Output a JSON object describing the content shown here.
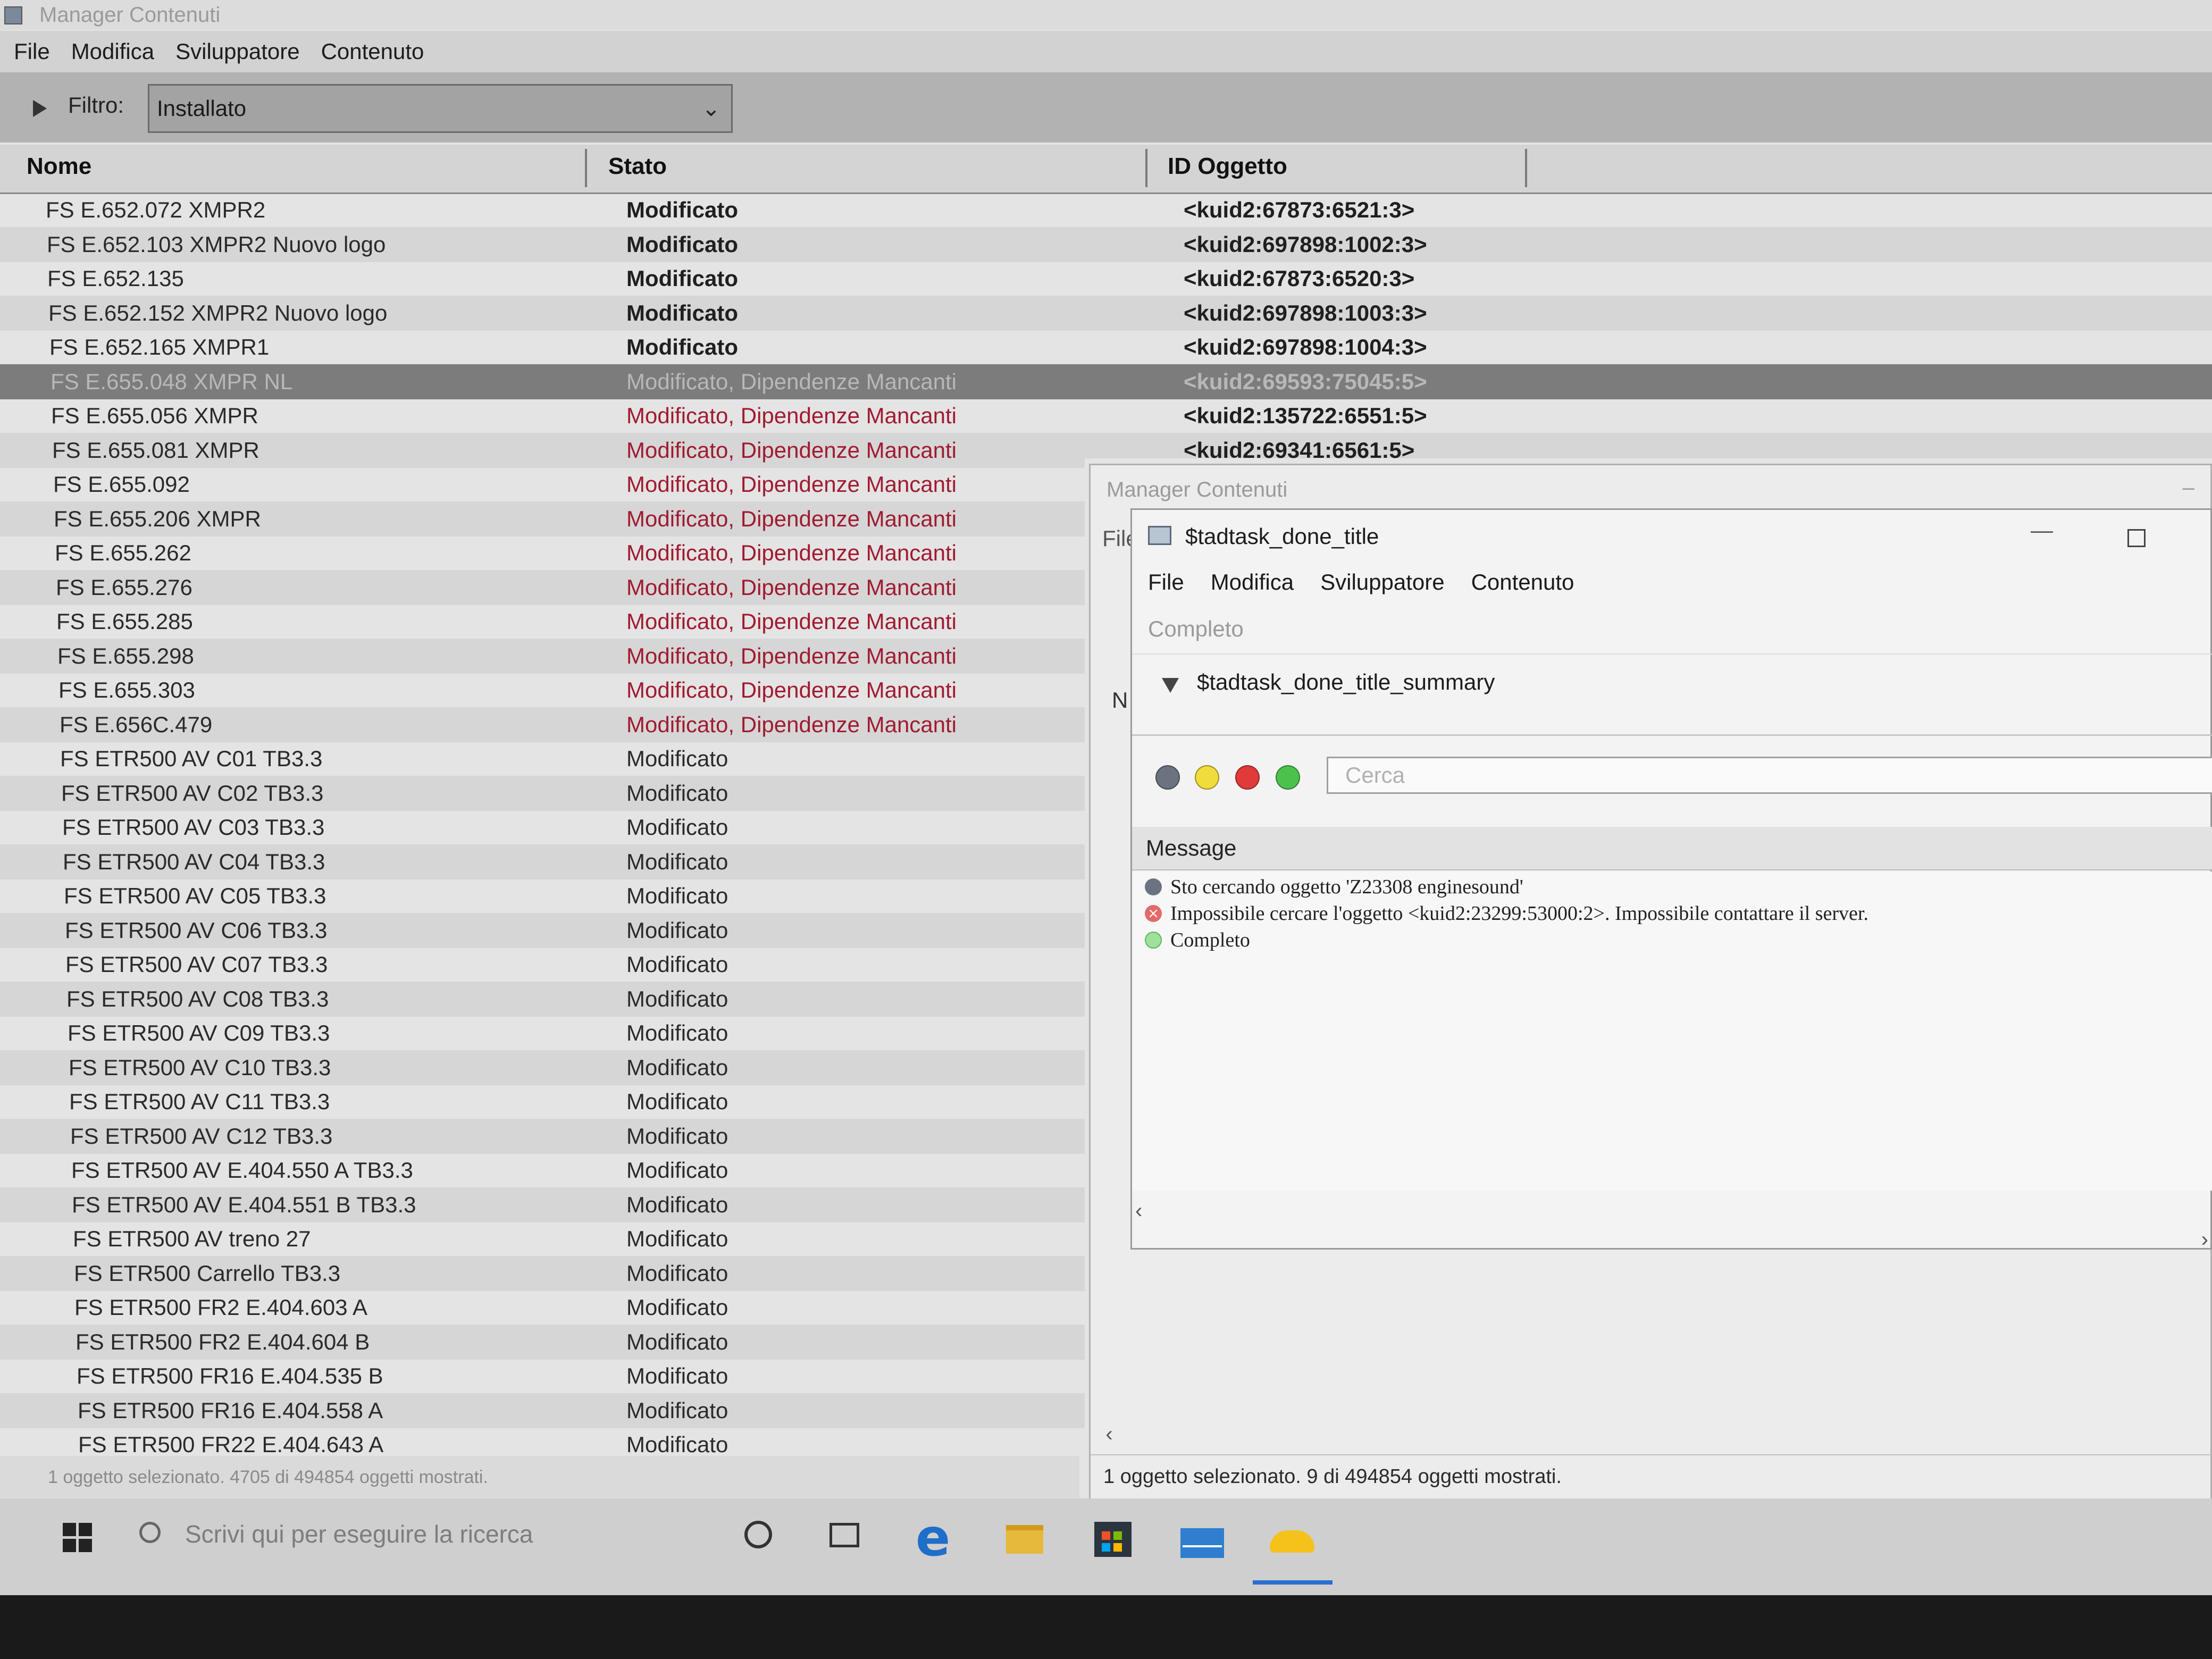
{
  "main_window": {
    "title": "Manager Contenuti",
    "menu": [
      "File",
      "Modifica",
      "Sviluppatore",
      "Contenuto"
    ],
    "filter": {
      "label": "Filtro:",
      "value": "Installato"
    },
    "columns": {
      "name": "Nome",
      "state": "Stato",
      "id": "ID Oggetto"
    },
    "rows": [
      {
        "name": "FS E.652.072 XMPR2",
        "state": "Modificato",
        "id": "<kuid2:67873:6521:3>"
      },
      {
        "name": "FS E.652.103 XMPR2 Nuovo logo",
        "state": "Modificato",
        "id": "<kuid2:697898:1002:3>"
      },
      {
        "name": "FS E.652.135",
        "state": "Modificato",
        "id": "<kuid2:67873:6520:3>"
      },
      {
        "name": "FS E.652.152 XMPR2 Nuovo logo",
        "state": "Modificato",
        "id": "<kuid2:697898:1003:3>"
      },
      {
        "name": "FS E.652.165 XMPR1",
        "state": "Modificato",
        "id": "<kuid2:697898:1004:3>"
      },
      {
        "name": "FS E.655.048 XMPR NL",
        "state": "Modificato, Dipendenze Mancanti",
        "id": "<kuid2:69593:75045:5>"
      },
      {
        "name": "FS E.655.056 XMPR",
        "state": "Modificato, Dipendenze Mancanti",
        "id": "<kuid2:135722:6551:5>"
      },
      {
        "name": "FS E.655.081 XMPR",
        "state": "Modificato, Dipendenze Mancanti",
        "id": "<kuid2:69341:6561:5>"
      },
      {
        "name": "FS E.655.092",
        "state": "Modificato, Dipendenze Mancanti",
        "id": ""
      },
      {
        "name": "FS E.655.206 XMPR",
        "state": "Modificato, Dipendenze Mancanti",
        "id": ""
      },
      {
        "name": "FS E.655.262",
        "state": "Modificato, Dipendenze Mancanti",
        "id": ""
      },
      {
        "name": "FS E.655.276",
        "state": "Modificato, Dipendenze Mancanti",
        "id": ""
      },
      {
        "name": "FS E.655.285",
        "state": "Modificato, Dipendenze Mancanti",
        "id": ""
      },
      {
        "name": "FS E.655.298",
        "state": "Modificato, Dipendenze Mancanti",
        "id": ""
      },
      {
        "name": "FS E.655.303",
        "state": "Modificato, Dipendenze Mancanti",
        "id": ""
      },
      {
        "name": "FS E.656C.479",
        "state": "Modificato, Dipendenze Mancanti",
        "id": ""
      },
      {
        "name": "FS ETR500 AV C01 TB3.3",
        "state": "Modificato",
        "id": ""
      },
      {
        "name": "FS ETR500 AV C02 TB3.3",
        "state": "Modificato",
        "id": ""
      },
      {
        "name": "FS ETR500 AV C03 TB3.3",
        "state": "Modificato",
        "id": ""
      },
      {
        "name": "FS ETR500 AV C04 TB3.3",
        "state": "Modificato",
        "id": ""
      },
      {
        "name": "FS ETR500 AV C05 TB3.3",
        "state": "Modificato",
        "id": ""
      },
      {
        "name": "FS ETR500 AV C06 TB3.3",
        "state": "Modificato",
        "id": ""
      },
      {
        "name": "FS ETR500 AV C07 TB3.3",
        "state": "Modificato",
        "id": ""
      },
      {
        "name": "FS ETR500 AV C08 TB3.3",
        "state": "Modificato",
        "id": ""
      },
      {
        "name": "FS ETR500 AV C09 TB3.3",
        "state": "Modificato",
        "id": ""
      },
      {
        "name": "FS ETR500 AV C10 TB3.3",
        "state": "Modificato",
        "id": ""
      },
      {
        "name": "FS ETR500 AV C11 TB3.3",
        "state": "Modificato",
        "id": ""
      },
      {
        "name": "FS ETR500 AV C12 TB3.3",
        "state": "Modificato",
        "id": ""
      },
      {
        "name": "FS ETR500 AV E.404.550 A TB3.3",
        "state": "Modificato",
        "id": ""
      },
      {
        "name": "FS ETR500 AV E.404.551 B TB3.3",
        "state": "Modificato",
        "id": ""
      },
      {
        "name": "FS ETR500 AV treno 27",
        "state": "Modificato",
        "id": ""
      },
      {
        "name": "FS ETR500 Carrello TB3.3",
        "state": "Modificato",
        "id": ""
      },
      {
        "name": "FS ETR500 FR2 E.404.603 A",
        "state": "Modificato",
        "id": ""
      },
      {
        "name": "FS ETR500 FR2 E.404.604 B",
        "state": "Modificato",
        "id": ""
      },
      {
        "name": "FS ETR500 FR16 E.404.535 B",
        "state": "Modificato",
        "id": ""
      },
      {
        "name": "FS ETR500 FR16 E.404.558 A",
        "state": "Modificato",
        "id": ""
      },
      {
        "name": "FS ETR500 FR22 E.404.643 A",
        "state": "Modificato",
        "id": ""
      }
    ],
    "status": "1 oggetto selezionato. 4705 di 494854 oggetti mostrati."
  },
  "second_window": {
    "title": "Manager Contenuti",
    "file_menu_fragment": "File",
    "column_fragment": "N",
    "status": "1 oggetto selezionato. 9 di 494854 oggetti mostrati."
  },
  "dialog": {
    "title": "$tadtask_done_title",
    "menu": [
      "File",
      "Modifica",
      "Sviluppatore",
      "Contenuto"
    ],
    "completo_label": "Completo",
    "summary": "$tadtask_done_title_summary",
    "search_placeholder": "Cerca",
    "filter_colors": {
      "gray": "#6b7280",
      "yellow": "#f0dc3c",
      "red": "#e03a3a",
      "green": "#4cc24c"
    },
    "log_header": "Message",
    "log": [
      {
        "kind": "info",
        "icon": "gray-dot-icon",
        "text": "Sto cercando oggetto 'Z23308 enginesound'"
      },
      {
        "kind": "error",
        "icon": "error-icon",
        "text": "Impossibile cercare l'oggetto <kuid2:23299:53000:2>. Impossibile contattare il server."
      },
      {
        "kind": "ok",
        "icon": "green-dot-icon",
        "text": "Completo"
      }
    ]
  },
  "taskbar": {
    "search_placeholder": "Scrivi qui per eseguire la ricerca",
    "icons": [
      "windows-start-icon",
      "search-icon",
      "cortana-icon",
      "task-view-icon",
      "edge-icon",
      "file-explorer-icon",
      "store-icon",
      "mail-icon",
      "content-manager-icon"
    ]
  }
}
